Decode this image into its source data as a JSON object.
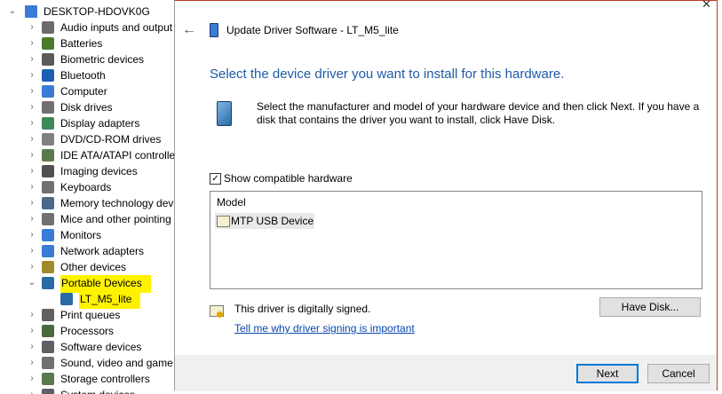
{
  "tree": {
    "root_label": "DESKTOP-HDOVK0G",
    "items": [
      {
        "label": "Audio inputs and output",
        "icon": "audio-icon",
        "color": "#6b6b6b",
        "expanded": false
      },
      {
        "label": "Batteries",
        "icon": "battery-icon",
        "color": "#4a7a2c",
        "expanded": false
      },
      {
        "label": "Biometric devices",
        "icon": "fingerprint-icon",
        "color": "#5a5a5a",
        "expanded": false
      },
      {
        "label": "Bluetooth",
        "icon": "bluetooth-icon",
        "color": "#1a5fb4",
        "expanded": false
      },
      {
        "label": "Computer",
        "icon": "computer-icon",
        "color": "#3a7bd5",
        "expanded": false
      },
      {
        "label": "Disk drives",
        "icon": "disk-drive-icon",
        "color": "#707070",
        "expanded": false
      },
      {
        "label": "Display adapters",
        "icon": "display-adapter-icon",
        "color": "#3a8a5a",
        "expanded": false
      },
      {
        "label": "DVD/CD-ROM drives",
        "icon": "dvd-drive-icon",
        "color": "#808080",
        "expanded": false
      },
      {
        "label": "IDE ATA/ATAPI controlle",
        "icon": "ide-controller-icon",
        "color": "#5a7a4a",
        "expanded": false
      },
      {
        "label": "Imaging devices",
        "icon": "camera-icon",
        "color": "#505050",
        "expanded": false
      },
      {
        "label": "Keyboards",
        "icon": "keyboard-icon",
        "color": "#707070",
        "expanded": false
      },
      {
        "label": "Memory technology dev",
        "icon": "memory-icon",
        "color": "#4a6a8a",
        "expanded": false
      },
      {
        "label": "Mice and other pointing",
        "icon": "mouse-icon",
        "color": "#707070",
        "expanded": false
      },
      {
        "label": "Monitors",
        "icon": "monitor-icon",
        "color": "#3a7bd5",
        "expanded": false
      },
      {
        "label": "Network adapters",
        "icon": "network-icon",
        "color": "#3a7bd5",
        "expanded": false
      },
      {
        "label": "Other devices",
        "icon": "unknown-device-icon",
        "color": "#a08a2a",
        "expanded": false
      },
      {
        "label": "Portable Devices",
        "icon": "portable-device-icon",
        "color": "#2a6aa5",
        "expanded": true,
        "highlight": true
      },
      {
        "label": "LT_M5_lite",
        "icon": "portable-device-icon",
        "color": "#2a6aa5",
        "child": true,
        "highlight": true
      },
      {
        "label": "Print queues",
        "icon": "printer-icon",
        "color": "#606060",
        "expanded": false
      },
      {
        "label": "Processors",
        "icon": "processor-icon",
        "color": "#4a6a3a",
        "expanded": false
      },
      {
        "label": "Software devices",
        "icon": "software-device-icon",
        "color": "#606060",
        "expanded": false
      },
      {
        "label": "Sound, video and game",
        "icon": "speaker-icon",
        "color": "#707070",
        "expanded": false
      },
      {
        "label": "Storage controllers",
        "icon": "storage-controller-icon",
        "color": "#5a7a4a",
        "expanded": false
      },
      {
        "label": "System devices",
        "icon": "system-device-icon",
        "color": "#606060",
        "expanded": false
      }
    ]
  },
  "dialog": {
    "title": "Update Driver Software - LT_M5_lite",
    "heading": "Select the device driver you want to install for this hardware.",
    "instructions": "Select the manufacturer and model of your hardware device and then click Next. If you have a disk that contains the driver you want to install, click Have Disk.",
    "show_compatible_label": "Show compatible hardware",
    "show_compatible_checked": true,
    "model_header": "Model",
    "models": [
      "MTP USB Device"
    ],
    "signed_text": "This driver is digitally signed.",
    "signing_link": "Tell me why driver signing is important",
    "have_disk_label": "Have Disk...",
    "next_label": "Next",
    "cancel_label": "Cancel",
    "close_glyph": "✕",
    "back_glyph": "←",
    "check_glyph": "✓"
  },
  "colors": {
    "heading": "#1e5aa8",
    "link": "#0645ad",
    "highlight": "#fff200",
    "accent": "#0078d7"
  }
}
